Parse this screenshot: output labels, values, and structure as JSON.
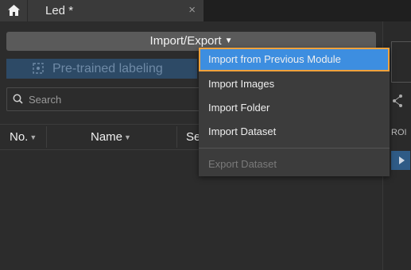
{
  "tabs": {
    "home_icon": "home-icon",
    "document_title": "Led *",
    "close_glyph": "×"
  },
  "toolbar": {
    "import_export_label": "Import/Export",
    "pretrained_label": "Pre-trained labeling"
  },
  "search": {
    "placeholder": "Search"
  },
  "table": {
    "columns": [
      {
        "label": "No."
      },
      {
        "label": "Name"
      },
      {
        "label": "Se"
      }
    ]
  },
  "right_panel": {
    "roi_label": "ROI"
  },
  "menu": {
    "items": [
      {
        "label": "Import from Previous Module",
        "state": "highlighted"
      },
      {
        "label": "Import Images",
        "state": "normal"
      },
      {
        "label": "Import Folder",
        "state": "normal"
      },
      {
        "label": "Import Dataset",
        "state": "normal"
      },
      {
        "label": "Export Dataset",
        "state": "disabled"
      }
    ]
  },
  "colors": {
    "highlight": "#3d8ee0",
    "highlight_border": "#f0a23c",
    "pretrained_bg": "#2d4a66"
  }
}
